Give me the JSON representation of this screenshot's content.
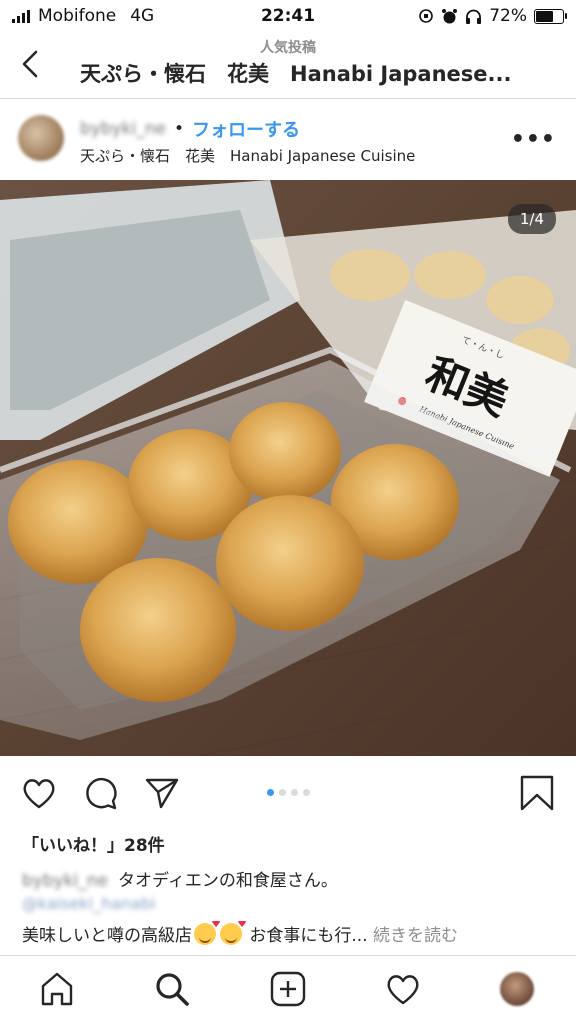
{
  "status_bar": {
    "carrier": "Mobifone",
    "network": "4G",
    "time": "22:41",
    "battery": "72%",
    "battery_level": 0.72
  },
  "header": {
    "subtitle": "人気投稿",
    "title": "天ぷら・懐石　花美　Hanabi Japanese...",
    "back_icon": "chevron-left-icon"
  },
  "post": {
    "username": "bybyki_ne",
    "separator": "•",
    "follow_label": "フォローする",
    "location": "天ぷら・懐石　花美　Hanabi Japanese Cuisine",
    "more_label": "•••",
    "image_counter": "1/4",
    "carousel_count": 4,
    "carousel_active": 1,
    "box_label_small": "て・ん・し",
    "box_brand": "和美",
    "box_brand_sub": "Hanabi Japanese Cuisine"
  },
  "actions": {
    "like_icon": "heart-icon",
    "comment_icon": "comment-icon",
    "share_icon": "send-icon",
    "save_icon": "bookmark-icon"
  },
  "likes": {
    "text": "「いいね！」28件"
  },
  "caption": {
    "username": "bybyki_ne",
    "text": "タオディエンの和食屋さん。",
    "tag": "@kaiseki_hanabi",
    "desc_before": "美味しいと噂の高級店",
    "desc_after": " お食事にも行...",
    "read_more": "続きを読む"
  },
  "nav": {
    "items": [
      "home-icon",
      "search-icon",
      "add-icon",
      "heart-icon",
      "profile-avatar"
    ]
  }
}
